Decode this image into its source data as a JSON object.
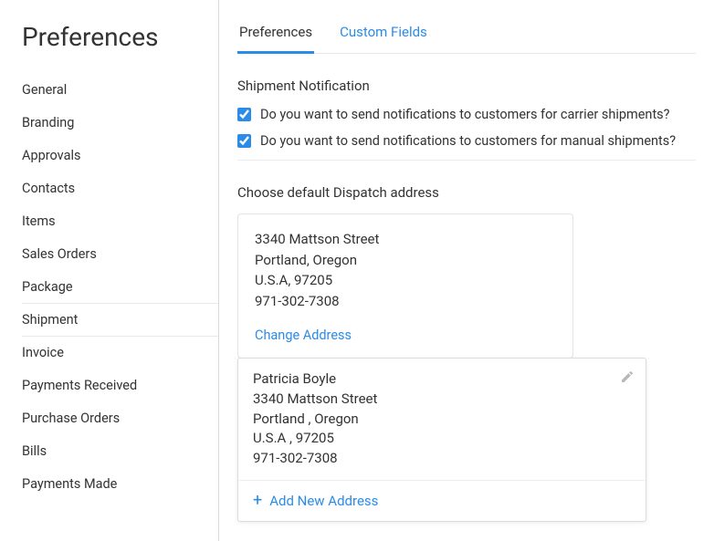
{
  "page_title": "Preferences",
  "sidebar": {
    "items": [
      {
        "label": "General"
      },
      {
        "label": "Branding"
      },
      {
        "label": "Approvals"
      },
      {
        "label": "Contacts"
      },
      {
        "label": "Items"
      },
      {
        "label": "Sales Orders"
      },
      {
        "label": "Package"
      },
      {
        "label": "Shipment"
      },
      {
        "label": "Invoice"
      },
      {
        "label": "Payments Received"
      },
      {
        "label": "Purchase Orders"
      },
      {
        "label": "Bills"
      },
      {
        "label": "Payments Made"
      }
    ]
  },
  "tabs": {
    "preferences": "Preferences",
    "custom_fields": "Custom Fields"
  },
  "notification": {
    "title": "Shipment Notification",
    "carrier_label": "Do you want to send notifications to customers for carrier shipments?",
    "manual_label": "Do you want to send notifications to customers for manual shipments?"
  },
  "dispatch": {
    "title": "Choose default Dispatch address",
    "default_address": {
      "line1": "3340 Mattson Street",
      "line2": "Portland, Oregon",
      "line3": "U.S.A, 97205",
      "line4": "971-302-7308"
    },
    "change_label": "Change Address"
  },
  "dropdown": {
    "option": {
      "name": "Patricia Boyle",
      "line1": "3340 Mattson Street",
      "line2": "Portland , Oregon",
      "line3": "U.S.A , 97205",
      "line4": "971-302-7308"
    },
    "add_new_label": "Add New Address"
  }
}
